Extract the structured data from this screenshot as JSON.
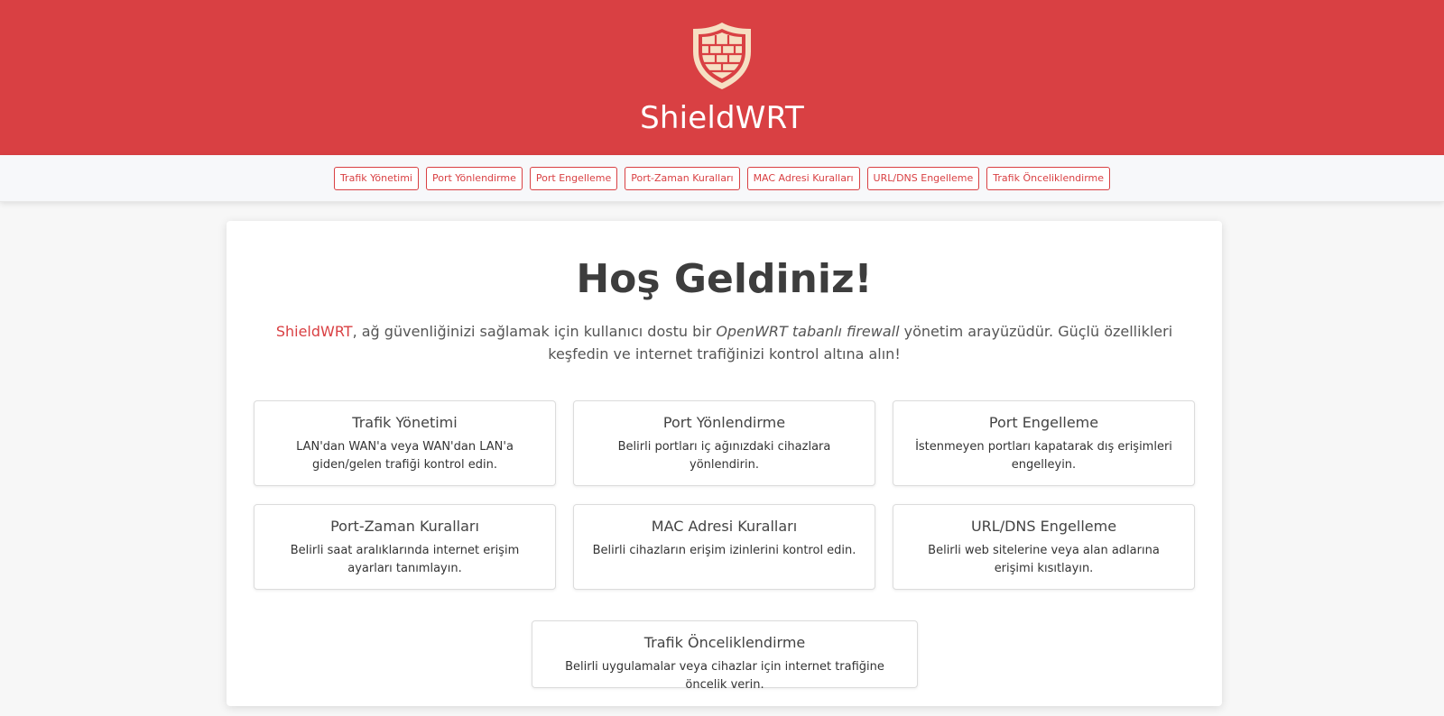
{
  "header": {
    "brand": "ShieldWRT",
    "logo_icon": "shield-wall-icon",
    "colors": {
      "primary": "#d94043",
      "logo_fill": "#f6dfc3"
    }
  },
  "nav": {
    "items": [
      {
        "label": "Trafik Yönetimi"
      },
      {
        "label": "Port Yönlendirme"
      },
      {
        "label": "Port Engelleme"
      },
      {
        "label": "Port-Zaman Kuralları"
      },
      {
        "label": "MAC Adresi Kuralları"
      },
      {
        "label": "URL/DNS Engelleme"
      },
      {
        "label": "Trafik Önceliklendirme"
      }
    ]
  },
  "welcome": {
    "title": "Hoş Geldiniz!",
    "intro_brand": "ShieldWRT",
    "intro_part1": ", ağ güvenliğinizi sağlamak için kullanıcı dostu bir ",
    "intro_em": "OpenWRT tabanlı firewall",
    "intro_part2": " yönetim arayüzüdür. Güçlü özellikleri keşfedin ve internet trafiğinizi kontrol altına alın!"
  },
  "features": [
    {
      "title": "Trafik Yönetimi",
      "desc": "LAN'dan WAN'a veya WAN'dan LAN'a giden/gelen trafiği kontrol edin."
    },
    {
      "title": "Port Yönlendirme",
      "desc": "Belirli portları iç ağınızdaki cihazlara yönlendirin."
    },
    {
      "title": "Port Engelleme",
      "desc": "İstenmeyen portları kapatarak dış erişimleri engelleyin."
    },
    {
      "title": "Port-Zaman Kuralları",
      "desc": "Belirli saat aralıklarında internet erişim ayarları tanımlayın."
    },
    {
      "title": "MAC Adresi Kuralları",
      "desc": "Belirli cihazların erişim izinlerini kontrol edin."
    },
    {
      "title": "URL/DNS Engelleme",
      "desc": "Belirli web sitelerine veya alan adlarına erişimi kısıtlayın."
    },
    {
      "title": "Trafik Önceliklendirme",
      "desc": "Belirli uygulamalar veya cihazlar için internet trafiğine öncelik verin."
    }
  ]
}
